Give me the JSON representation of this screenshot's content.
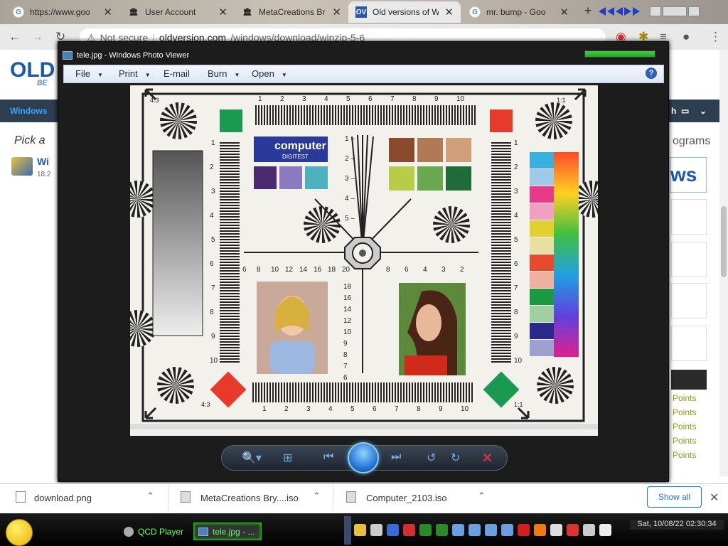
{
  "browser": {
    "tabs": [
      {
        "title": "https://www.goo",
        "icon": "google-icon"
      },
      {
        "title": "User Account",
        "icon": "museum-icon"
      },
      {
        "title": "MetaCreations Br",
        "icon": "museum-icon"
      },
      {
        "title": "Old versions of W",
        "icon": "ov-icon",
        "favicon_text": "OV"
      },
      {
        "title": "mr. bump - Goo",
        "icon": "google-icon"
      }
    ],
    "new_tab": "+",
    "address": {
      "prefix": "Not secure",
      "url_host": "oldversion.com",
      "url_path": "/windows/download/winzip-5-6"
    }
  },
  "website": {
    "logo": "OLD",
    "logo_sub": "BE",
    "nav_left": "Windows",
    "nav_right": "h",
    "pick_text": "Pick a",
    "left_link": "Wi",
    "left_small": "18.2",
    "right_heading": "ograms",
    "ws_badge": "ws",
    "points": [
      "Points",
      "Points",
      "Points",
      "Points",
      "Points"
    ]
  },
  "viewer": {
    "title": "tele.jpg - Windows Photo Viewer",
    "menu": [
      {
        "label": "File",
        "arrow": "▼"
      },
      {
        "label": "Print",
        "arrow": "▼"
      },
      {
        "label": "E-mail",
        "arrow": ""
      },
      {
        "label": "Burn",
        "arrow": "▼"
      },
      {
        "label": "Open",
        "arrow": "▼"
      }
    ],
    "help": "?",
    "image": {
      "brand_line1": "computer",
      "brand_line2": "DIGITEST",
      "top_scale": [
        "1",
        "2",
        "3",
        "4",
        "5",
        "6",
        "7",
        "8",
        "9",
        "10"
      ],
      "left_scale": [
        "1",
        "2",
        "3",
        "4",
        "5",
        "6",
        "7",
        "8",
        "9",
        "10"
      ],
      "right_scale": [
        "1",
        "2",
        "3",
        "4",
        "5",
        "6",
        "7",
        "8",
        "9",
        "10"
      ],
      "center_top": [
        "1",
        "2",
        "3",
        "4",
        "5"
      ],
      "horizontal_scale_left": [
        "6",
        "8",
        "10",
        "12",
        "14",
        "16",
        "18",
        "20"
      ],
      "horizontal_scale_right": [
        "8",
        "6",
        "4",
        "3",
        "2"
      ],
      "center_vertical": [
        "18",
        "16",
        "14",
        "12",
        "10",
        "9",
        "8",
        "7",
        "6"
      ],
      "bottom_scale": [
        "1",
        "2",
        "3",
        "4",
        "5",
        "6",
        "7",
        "8",
        "9",
        "10"
      ],
      "corner_labels": [
        "4:3",
        "1:1",
        "4:3",
        "1:1",
        "4:3",
        "1:1",
        "4:3",
        "1:1"
      ],
      "swatches_top_right": [
        "#8b4a2b",
        "#b07a55",
        "#cfa07a",
        "#b9cc4a",
        "#6aa84f",
        "#1f6b3a"
      ],
      "swatches_top_left": [
        "#4a2a6e",
        "#8a7bc0",
        "#4fb0c0"
      ],
      "color_column": [
        "#3ab0e0",
        "#a0c8e8",
        "#e83a8a",
        "#f0a0c0",
        "#e0d030",
        "#e8e0a0",
        "#e84a30",
        "#f0b0a0",
        "#1a9a40",
        "#a0d0a0",
        "#2a2a8a",
        "#a0a0d0"
      ]
    }
  },
  "downloads": {
    "items": [
      {
        "name": "download.png",
        "icon": "image-file-icon"
      },
      {
        "name": "MetaCreations Bry....iso",
        "icon": "iso-file-icon"
      },
      {
        "name": "Computer_2103.iso",
        "icon": "iso-file-icon"
      }
    ],
    "show_all": "Show all",
    "close": "✕"
  },
  "taskbar": {
    "apps": [
      {
        "label": "QCD Player",
        "icon": "qcd-player-icon"
      },
      {
        "label": "tele.jpg - ...",
        "icon": "photo-viewer-icon"
      }
    ],
    "clock": "Sat, 10/08/22 02:30:34",
    "tray_colors": [
      "#e8c040",
      "#ccc",
      "#3a6ad8",
      "#d03030",
      "#2a8a2a",
      "#2a8a2a",
      "#6aa0e0",
      "#6aa0e0",
      "#6aa0e0",
      "#6aa0e0",
      "#d02020",
      "#f07a10",
      "#ddd",
      "#e03030",
      "#ccc",
      "#eee"
    ]
  }
}
